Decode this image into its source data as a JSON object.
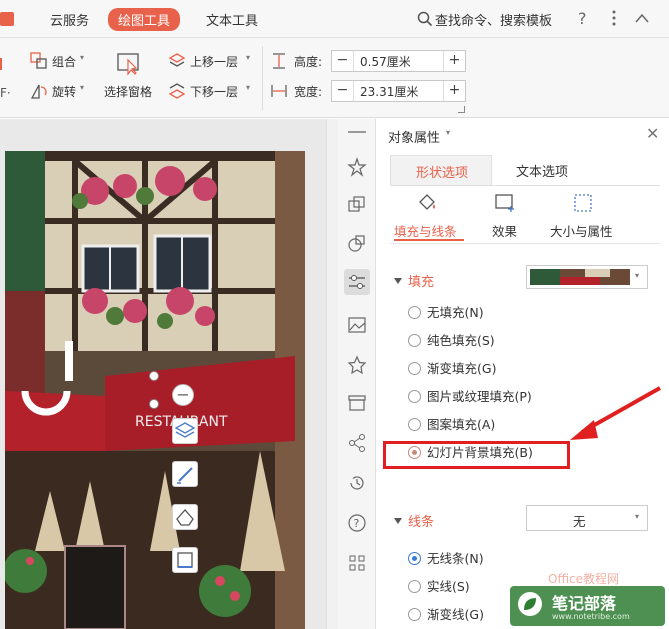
{
  "menu": {
    "cloud_service": "云服务",
    "drawing_tools": "绘图工具",
    "text_tools": "文本工具",
    "search": "查找命令、搜索模板"
  },
  "ribbon": {
    "group_label": "组合",
    "rotate_label": "旋转",
    "selection_pane": "选择窗格",
    "bring_forward": "上移一层",
    "send_backward": "下移一层",
    "height_label": "高度:",
    "height_value": "0.57厘米",
    "width_label": "宽度:",
    "width_value": "23.31厘米",
    "minus": "−",
    "plus": "+"
  },
  "panel": {
    "title": "对象属性",
    "tabs": {
      "shape": "形状选项",
      "text": "文本选项"
    },
    "subtabs": {
      "fill_line": "填充与线条",
      "effects": "效果",
      "size_props": "大小与属性"
    },
    "fill_section": "填充",
    "fill_options": [
      "无填充(N)",
      "纯色填充(S)",
      "渐变填充(G)",
      "图片或纹理填充(P)",
      "图案填充(A)",
      "幻灯片背景填充(B)"
    ],
    "fill_selected_index": 5,
    "line_section": "线条",
    "line_dropdown_value": "无",
    "line_options": [
      "无线条(N)",
      "实线(S)",
      "渐变线(G)"
    ],
    "line_selected_index": 0
  },
  "watermark": {
    "site": "笔记部落",
    "url": "www.notetribe.com",
    "office": "Office教程网"
  },
  "colors": {
    "accent": "#e8614a",
    "highlight_box": "#e02020",
    "selected_radio": "#3a7bd5"
  },
  "slide_text": "RESTAURANT"
}
